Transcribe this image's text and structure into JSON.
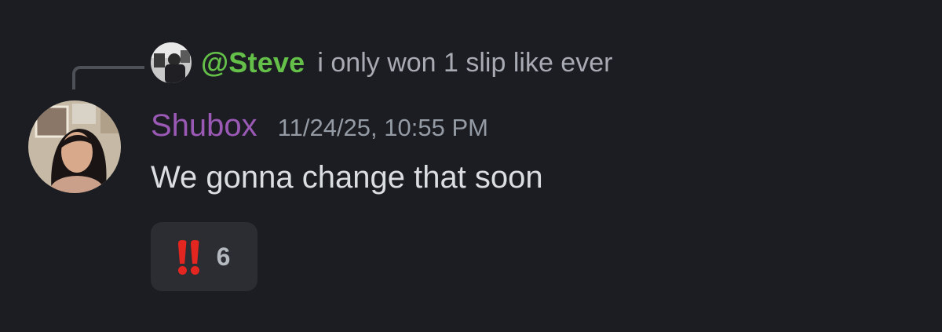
{
  "reply": {
    "author": "@Steve",
    "text": "i only won 1 slip like ever",
    "author_color": "#65c04a"
  },
  "message": {
    "username": "Shubox",
    "username_color": "#9b59b6",
    "timestamp": "11/24/25, 10:55 PM",
    "content": "We gonna change that soon"
  },
  "reactions": [
    {
      "emoji": "double-exclamation-icon",
      "count": "6"
    }
  ],
  "colors": {
    "background": "#1c1d22",
    "reaction_bg": "#2b2d33",
    "emoji_red": "#e3261f"
  }
}
